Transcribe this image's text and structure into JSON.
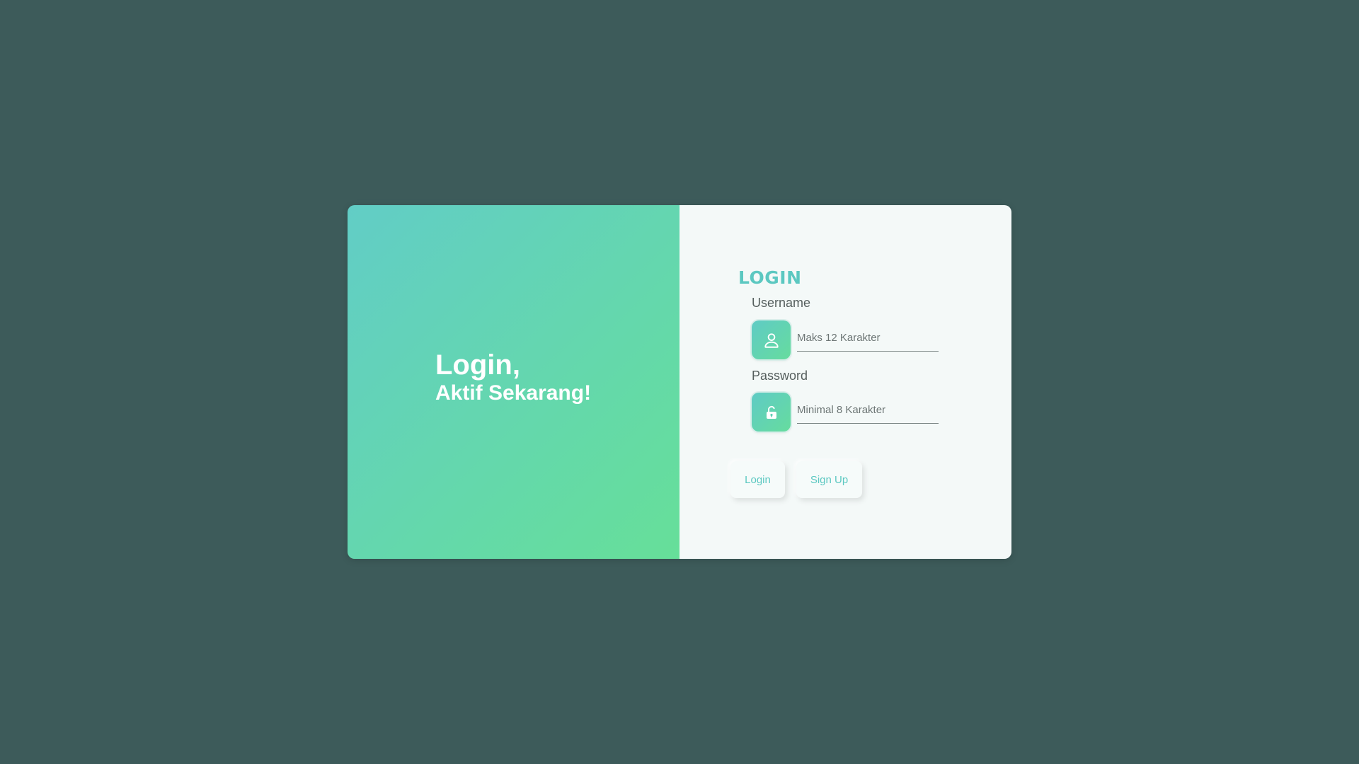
{
  "hero": {
    "title": "Login,",
    "subtitle": "Aktif Sekarang!"
  },
  "form": {
    "heading": "LOGIN",
    "username": {
      "label": "Username",
      "placeholder": "Maks 12 Karakter",
      "icon": "user-icon"
    },
    "password": {
      "label": "Password",
      "placeholder": "Minimal 8 Karakter",
      "icon": "unlock-icon"
    },
    "buttons": {
      "login": "Login",
      "signup": "Sign Up"
    }
  },
  "colors": {
    "background": "#3d5b5a",
    "accent": "#5cc8c1",
    "gradient_start": "#62cdc6",
    "gradient_end": "#66df99",
    "panel": "#f4f9f8"
  }
}
